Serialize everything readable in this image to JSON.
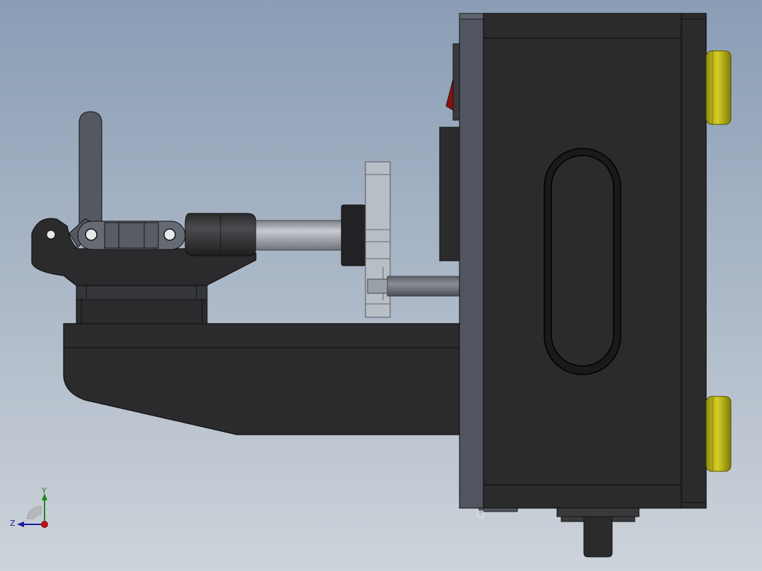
{
  "viewport": {
    "background_top": "#8a9db5",
    "background_bottom": "#cdd3da"
  },
  "colors": {
    "body_dark": "#2b2b2d",
    "body_mid": "#3a3a3c",
    "edge": "#111111",
    "plate": "#505560",
    "plate_light": "#5e636e",
    "handle": "#555861",
    "rod": "#9a9ea4",
    "rod_light": "#c8ccd2",
    "disc": "#b8bec6",
    "knob_yellow": "#c8c21a",
    "knob_yellow_dark": "#8f8a0e",
    "switch_red": "#8a1010",
    "axis_y": "#1a8a1a",
    "axis_z": "#1a1a9a",
    "axis_x": "#c01010"
  },
  "triad": {
    "y_label": "Y",
    "z_label": "Z"
  }
}
